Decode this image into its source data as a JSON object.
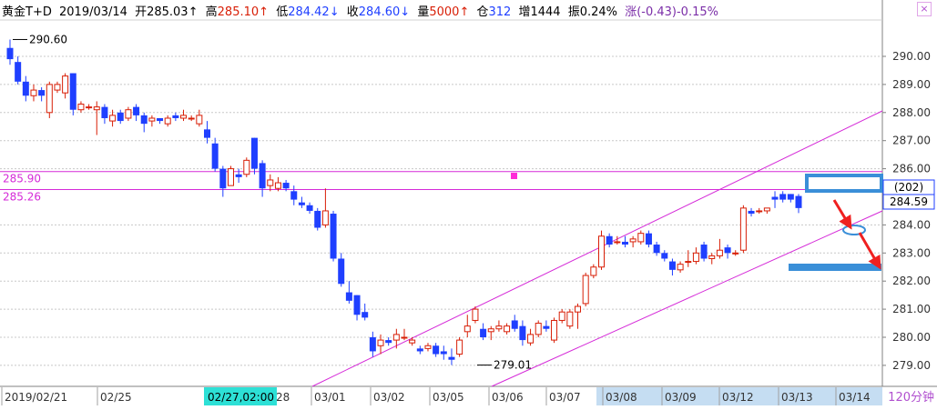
{
  "header": {
    "symbol": "黄金T+D",
    "date": "2019/03/14",
    "open_label": "开",
    "open": "285.03",
    "high_label": "高",
    "high": "285.10",
    "low_label": "低",
    "low": "284.42",
    "close_label": "收",
    "close": "284.60",
    "volume_label": "量",
    "volume": "5000",
    "oi_label": "仓",
    "oi": "312",
    "inc_label": "增",
    "inc": "1444",
    "amp_label": "振",
    "amp": "0.24%",
    "chg_label": "涨",
    "chg": "(-0.43)-0.15%",
    "up_arrow": "↑",
    "down_arrow": "↓"
  },
  "close_glyph": "×",
  "colors": {
    "up": "#d81e06",
    "down": "#1f3fff",
    "trend": "#d52ad8",
    "grid": "#c8c8c8",
    "zone": "#3a8fd8",
    "red_arrow": "#ef2020",
    "axis_bg": "#c5ddf2",
    "cursor_bg": "#2de0d6"
  },
  "right_axis": {
    "ticks": [
      "290.00",
      "289.00",
      "288.00",
      "287.00",
      "286.00",
      "284.00",
      "283.00",
      "282.00",
      "281.00",
      "280.00",
      "279.00"
    ],
    "current_count": "(202)",
    "current_price": "284.59"
  },
  "annotations": {
    "max_label": "290.60",
    "min_label": "279.01",
    "hline_upper": "285.90",
    "hline_lower": "285.26"
  },
  "bottom_axis": {
    "labels": [
      "2019/02/21",
      "02/25",
      "/28",
      "03/01",
      "03/02",
      "03/05",
      "03/06",
      "03/07",
      "03/08",
      "03/09",
      "03/12",
      "03/13",
      "03/14"
    ],
    "cursor_label": "02/27,02:00",
    "period": "120分钟"
  },
  "chart_data": {
    "type": "candlestick",
    "ylim": [
      278.7,
      291.5
    ],
    "candles": [
      [
        290.3,
        290.6,
        289.7,
        289.9
      ],
      [
        289.8,
        290.0,
        289.0,
        289.1
      ],
      [
        289.1,
        289.3,
        288.4,
        288.6
      ],
      [
        288.6,
        289.0,
        288.4,
        288.8
      ],
      [
        288.8,
        288.9,
        288.4,
        288.6
      ],
      [
        288.0,
        289.1,
        287.8,
        289.0
      ],
      [
        288.8,
        289.1,
        288.7,
        289.0
      ],
      [
        288.7,
        289.4,
        288.5,
        289.3
      ],
      [
        289.4,
        289.4,
        287.9,
        288.1
      ],
      [
        288.1,
        288.4,
        288.0,
        288.3
      ],
      [
        288.2,
        288.3,
        288.1,
        288.2
      ],
      [
        288.1,
        288.4,
        287.2,
        288.2
      ],
      [
        288.2,
        288.3,
        287.6,
        287.8
      ],
      [
        287.7,
        288.1,
        287.5,
        287.9
      ],
      [
        288.0,
        288.1,
        287.6,
        287.7
      ],
      [
        287.8,
        288.2,
        287.7,
        288.1
      ],
      [
        288.2,
        288.3,
        287.7,
        287.9
      ],
      [
        287.9,
        288.0,
        287.3,
        287.6
      ],
      [
        287.7,
        287.9,
        287.5,
        287.8
      ],
      [
        287.8,
        287.8,
        287.6,
        287.7
      ],
      [
        287.6,
        287.9,
        287.5,
        287.8
      ],
      [
        287.9,
        288.0,
        287.7,
        287.8
      ],
      [
        287.8,
        288.1,
        287.7,
        287.9
      ],
      [
        287.8,
        287.9,
        287.7,
        287.8
      ],
      [
        287.6,
        288.1,
        287.5,
        287.9
      ],
      [
        287.4,
        287.7,
        286.9,
        287.1
      ],
      [
        286.9,
        287.1,
        285.9,
        286.0
      ],
      [
        286.0,
        286.1,
        285.0,
        285.3
      ],
      [
        285.4,
        286.1,
        285.4,
        286.0
      ],
      [
        285.8,
        286.0,
        285.5,
        285.7
      ],
      [
        285.8,
        286.4,
        285.7,
        286.3
      ],
      [
        287.1,
        287.1,
        285.8,
        286.0
      ],
      [
        286.2,
        286.3,
        285.0,
        285.3
      ],
      [
        285.4,
        285.8,
        285.2,
        285.6
      ],
      [
        285.3,
        285.7,
        285.2,
        285.5
      ],
      [
        285.5,
        285.6,
        285.2,
        285.3
      ],
      [
        285.2,
        285.4,
        284.7,
        284.9
      ],
      [
        284.8,
        285.0,
        284.6,
        284.7
      ],
      [
        284.7,
        284.8,
        284.4,
        284.5
      ],
      [
        284.5,
        284.6,
        283.8,
        283.9
      ],
      [
        284.0,
        285.3,
        283.9,
        284.5
      ],
      [
        284.4,
        284.5,
        282.7,
        282.8
      ],
      [
        282.8,
        283.0,
        281.8,
        281.9
      ],
      [
        281.6,
        282.0,
        281.2,
        281.3
      ],
      [
        281.5,
        281.5,
        280.6,
        280.8
      ],
      [
        280.9,
        281.2,
        280.6,
        280.7
      ],
      [
        280.0,
        280.2,
        279.3,
        279.5
      ],
      [
        279.7,
        280.1,
        279.4,
        279.9
      ],
      [
        279.9,
        280.0,
        279.7,
        279.8
      ],
      [
        279.9,
        280.3,
        279.6,
        280.1
      ],
      [
        280.0,
        280.3,
        279.9,
        280.0
      ],
      [
        279.8,
        280.0,
        279.7,
        279.9
      ],
      [
        279.6,
        279.7,
        279.4,
        279.5
      ],
      [
        279.6,
        279.8,
        279.5,
        279.7
      ],
      [
        279.7,
        279.8,
        279.3,
        279.4
      ],
      [
        279.5,
        279.7,
        279.2,
        279.4
      ],
      [
        279.3,
        279.6,
        279.01,
        279.2
      ],
      [
        279.4,
        280.0,
        279.3,
        279.9
      ],
      [
        280.2,
        280.8,
        280.0,
        280.4
      ],
      [
        280.6,
        281.1,
        280.5,
        281.0
      ],
      [
        280.3,
        280.5,
        279.9,
        280.0
      ],
      [
        280.2,
        280.4,
        279.9,
        280.3
      ],
      [
        280.3,
        280.6,
        280.2,
        280.4
      ],
      [
        280.2,
        280.5,
        280.1,
        280.4
      ],
      [
        280.6,
        280.8,
        280.2,
        280.3
      ],
      [
        280.4,
        280.6,
        279.7,
        279.9
      ],
      [
        279.8,
        280.3,
        279.7,
        280.1
      ],
      [
        280.1,
        280.6,
        280.0,
        280.5
      ],
      [
        280.4,
        280.6,
        280.2,
        280.3
      ],
      [
        279.9,
        280.7,
        279.8,
        280.6
      ],
      [
        280.6,
        281.0,
        280.5,
        280.9
      ],
      [
        280.4,
        281.0,
        280.3,
        280.9
      ],
      [
        280.9,
        281.2,
        280.3,
        281.1
      ],
      [
        281.2,
        282.3,
        281.1,
        282.2
      ],
      [
        282.2,
        282.6,
        282.1,
        282.5
      ],
      [
        282.5,
        283.8,
        282.4,
        283.6
      ],
      [
        283.6,
        283.7,
        283.2,
        283.3
      ],
      [
        283.4,
        283.6,
        283.3,
        283.4
      ],
      [
        283.4,
        283.6,
        283.2,
        283.3
      ],
      [
        283.4,
        283.6,
        283.2,
        283.5
      ],
      [
        283.4,
        283.8,
        283.3,
        283.7
      ],
      [
        283.7,
        283.8,
        283.2,
        283.3
      ],
      [
        283.3,
        283.4,
        282.9,
        283.0
      ],
      [
        283.0,
        283.1,
        282.7,
        282.8
      ],
      [
        282.7,
        282.8,
        282.2,
        282.4
      ],
      [
        282.4,
        282.7,
        282.3,
        282.6
      ],
      [
        282.7,
        283.1,
        282.5,
        282.7
      ],
      [
        282.7,
        283.2,
        282.6,
        283.0
      ],
      [
        283.3,
        283.4,
        282.7,
        282.8
      ],
      [
        282.8,
        283.0,
        282.6,
        282.9
      ],
      [
        282.9,
        283.5,
        282.8,
        283.1
      ],
      [
        283.2,
        283.3,
        282.8,
        283.0
      ],
      [
        283.0,
        283.1,
        282.9,
        283.0
      ],
      [
        283.1,
        284.7,
        283.0,
        284.6
      ],
      [
        284.5,
        284.6,
        284.3,
        284.4
      ],
      [
        284.5,
        284.6,
        284.4,
        284.5
      ],
      [
        284.5,
        284.6,
        284.4,
        284.6
      ],
      [
        285.0,
        285.2,
        284.6,
        284.9
      ],
      [
        285.1,
        285.2,
        284.8,
        284.9
      ],
      [
        285.1,
        285.1,
        284.8,
        284.9
      ],
      [
        285.03,
        285.1,
        284.42,
        284.6
      ]
    ]
  }
}
